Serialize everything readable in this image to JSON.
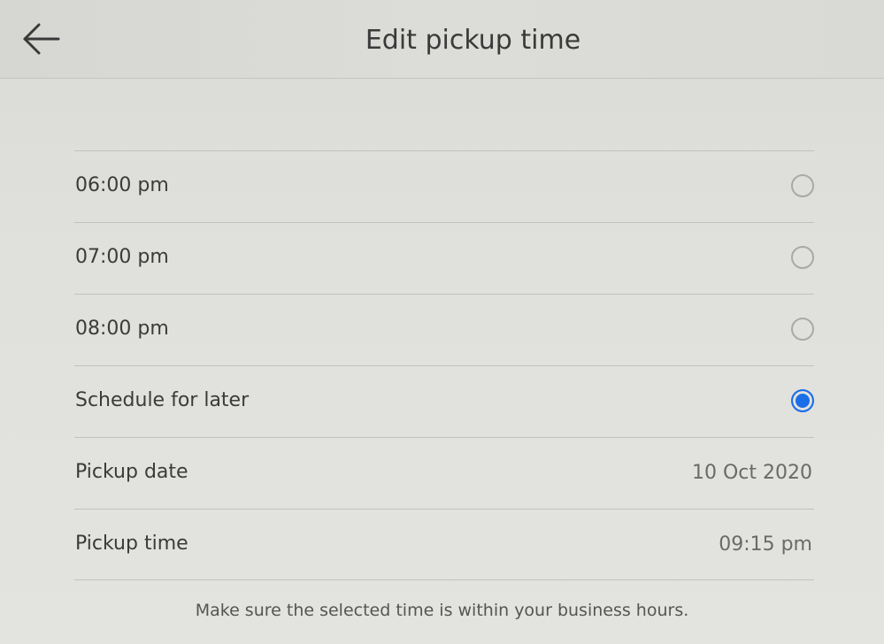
{
  "header": {
    "title": "Edit pickup time",
    "back_icon": "arrow-left-icon"
  },
  "options": [
    {
      "label": "06:00 pm",
      "selected": false
    },
    {
      "label": "07:00 pm",
      "selected": false
    },
    {
      "label": "08:00 pm",
      "selected": false
    },
    {
      "label": "Schedule for later",
      "selected": true
    }
  ],
  "details": {
    "date_label": "Pickup date",
    "date_value": "10 Oct 2020",
    "time_label": "Pickup time",
    "time_value": "09:15 pm"
  },
  "hint": "Make sure the selected time is within your business hours.",
  "colors": {
    "accent": "#1a6fe8"
  }
}
